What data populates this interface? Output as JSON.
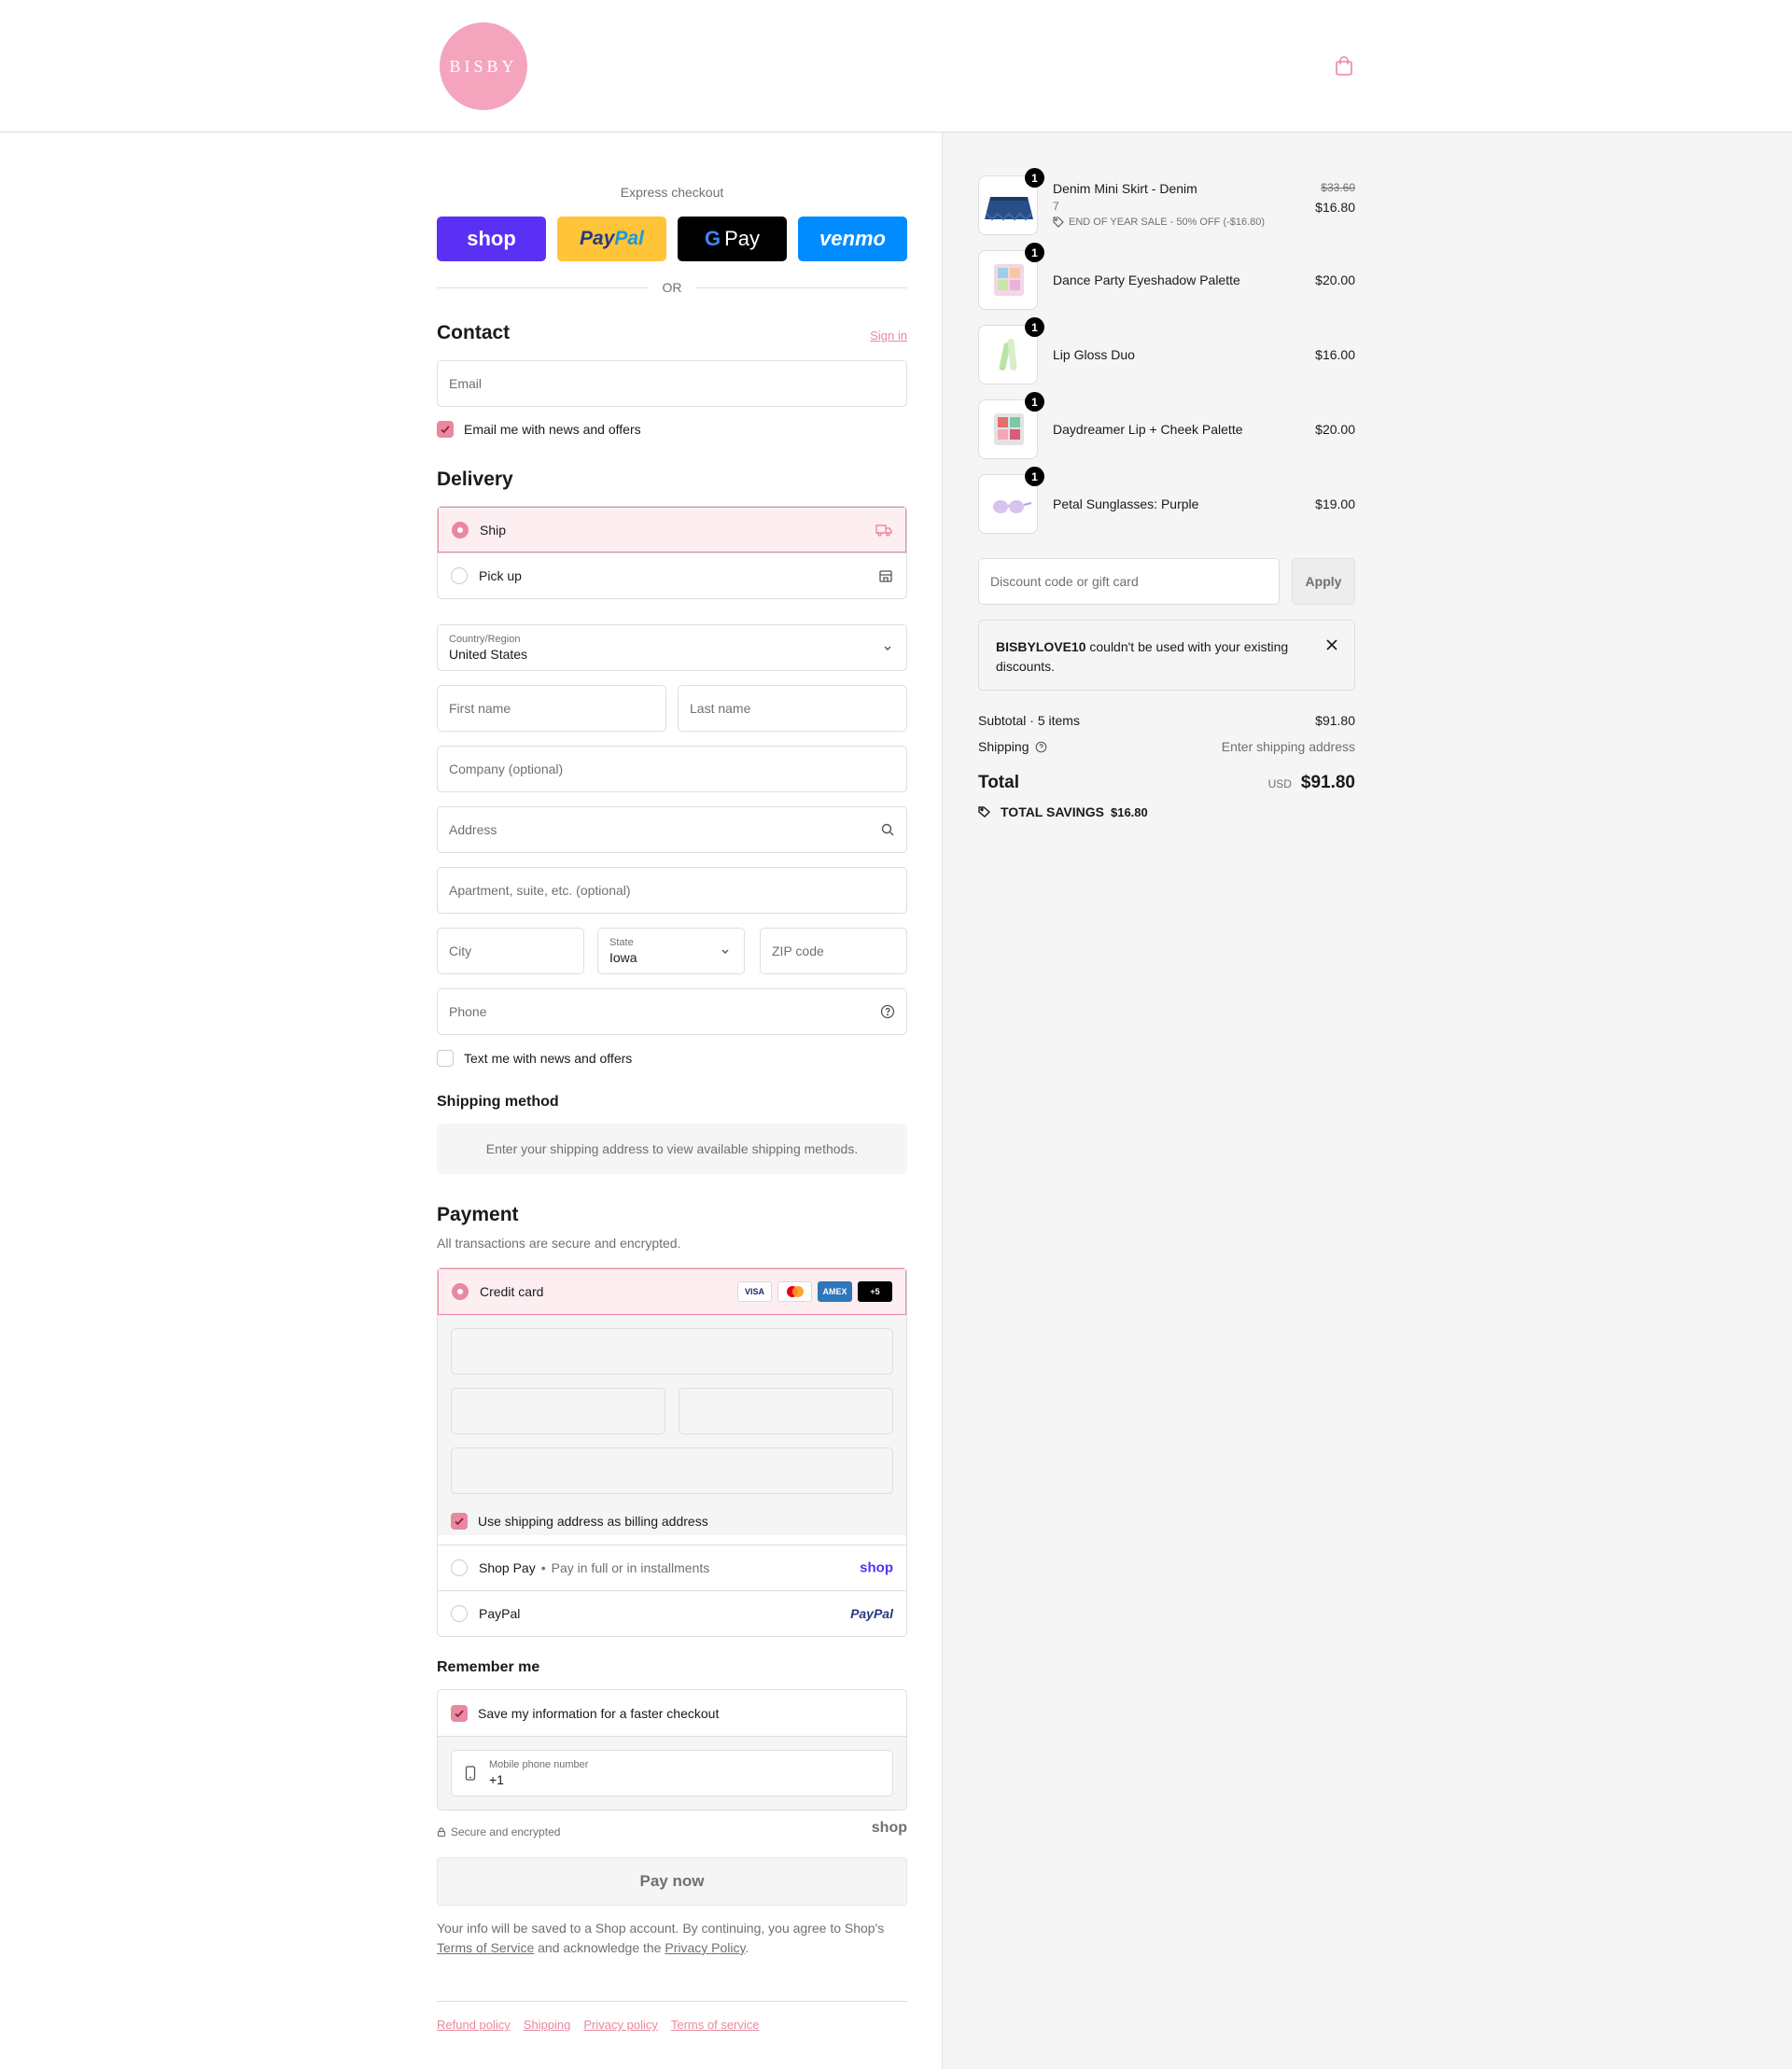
{
  "header": {
    "logo_text": "BISBY",
    "cart_icon": "shopping-bag-icon"
  },
  "express": {
    "label": "Express checkout",
    "shop": "shop",
    "paypal_a": "Pay",
    "paypal_b": "Pal",
    "gpay_g": "G",
    "gpay": "Pay",
    "venmo": "venmo",
    "or": "OR"
  },
  "contact": {
    "heading": "Contact",
    "sign_in": "Sign in",
    "email_placeholder": "Email",
    "news_label": "Email me with news and offers",
    "news_checked": true
  },
  "delivery": {
    "heading": "Delivery",
    "options": [
      {
        "label": "Ship",
        "selected": true,
        "icon": "truck-icon"
      },
      {
        "label": "Pick up",
        "selected": false,
        "icon": "store-icon"
      }
    ],
    "country_label": "Country/Region",
    "country_value": "United States",
    "first_name": "First name",
    "last_name": "Last name",
    "company": "Company (optional)",
    "address": "Address",
    "apartment": "Apartment, suite, etc. (optional)",
    "city": "City",
    "state_label": "State",
    "state_value": "Iowa",
    "zip": "ZIP code",
    "phone": "Phone",
    "text_label": "Text me with news and offers"
  },
  "shipping_method": {
    "heading": "Shipping method",
    "info": "Enter your shipping address to view available shipping methods."
  },
  "payment": {
    "heading": "Payment",
    "subtitle": "All transactions are secure and encrypted.",
    "credit_card": "Credit card",
    "badges": [
      "VISA",
      "",
      "AMEX",
      "+5"
    ],
    "billing_label": "Use shipping address as billing address",
    "shop_pay": "Shop Pay",
    "shop_pay_note": "Pay in full or in installments",
    "shop_logo": "shop",
    "paypal": "PayPal",
    "paypal_logo": "PayPal"
  },
  "remember": {
    "heading": "Remember me",
    "save_label": "Save my information for a faster checkout",
    "phone_label": "Mobile phone number",
    "phone_value": "+1",
    "secure": "Secure and encrypted",
    "shop_logo": "shop"
  },
  "pay_now": "Pay now",
  "legal": {
    "a": "Your info will be saved to a Shop account. By continuing, you agree to Shop's",
    "terms": "Terms of Service",
    "b": "and acknowledge the",
    "privacy": "Privacy Policy",
    "c": "."
  },
  "footer": [
    "Refund policy",
    "Shipping",
    "Privacy policy",
    "Terms of service"
  ],
  "summary": {
    "items": [
      {
        "name": "Denim Mini Skirt - Denim",
        "variant": "7",
        "qty": "1",
        "old_price": "$33.60",
        "price": "$16.80",
        "discount": "END OF YEAR SALE - 50% OFF (-$16.80)"
      },
      {
        "name": "Dance Party Eyeshadow Palette",
        "qty": "1",
        "price": "$20.00"
      },
      {
        "name": "Lip Gloss Duo",
        "qty": "1",
        "price": "$16.00"
      },
      {
        "name": "Daydreamer Lip + Cheek Palette",
        "qty": "1",
        "price": "$20.00"
      },
      {
        "name": "Petal Sunglasses: Purple",
        "qty": "1",
        "price": "$19.00"
      }
    ],
    "discount_placeholder": "Discount code or gift card",
    "apply": "Apply",
    "alert_code": "BISBYLOVE10",
    "alert_text": "couldn't be used with your existing discounts.",
    "subtotal_label": "Subtotal · 5 items",
    "subtotal": "$91.80",
    "shipping_label": "Shipping",
    "shipping_value": "Enter shipping address",
    "total_label": "Total",
    "currency": "USD",
    "total": "$91.80",
    "savings_label": "TOTAL SAVINGS",
    "savings": "$16.80"
  }
}
